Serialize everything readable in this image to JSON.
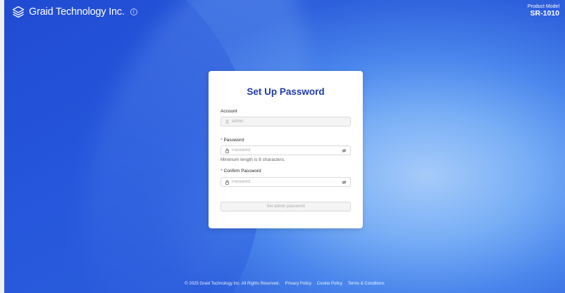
{
  "header": {
    "logo_text": "Graid Technology Inc.",
    "model_label": "Product Model",
    "model_value": "SR-1010"
  },
  "form": {
    "title": "Set Up Password",
    "account": {
      "label": "Account",
      "placeholder": "admin"
    },
    "password": {
      "label": "Password",
      "required_mark": "*",
      "placeholder": "Password",
      "hint": "Minimum length is 8 characters."
    },
    "confirm": {
      "label": "Confirm Password",
      "required_mark": "*",
      "placeholder": "Password"
    },
    "submit_label": "Set admin password"
  },
  "footer": {
    "copyright": "© 2025 Graid Technology Inc. All Rights Reserved.",
    "privacy": "Privacy Policy",
    "cookie": "Cookie Policy",
    "terms": "Terms & Conditions"
  },
  "icons": {
    "logo": "layered-stack-logo",
    "account_field": "user-icon",
    "password_field": "lock-icon",
    "visibility": "eye-off-icon",
    "info": "info-icon"
  },
  "colors": {
    "title": "#1f3aa8",
    "background_dark": "#1d47cf",
    "background_light": "#a6cbfa",
    "required": "#e23a3a"
  }
}
